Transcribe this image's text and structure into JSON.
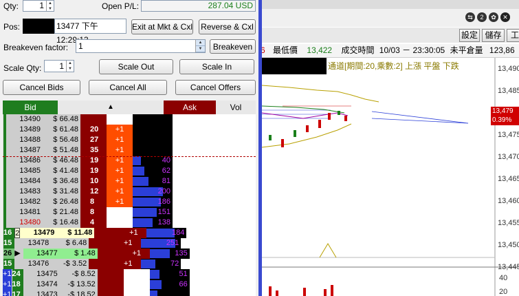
{
  "order_panel": {
    "qty_label": "Qty:",
    "qty_value": "1",
    "open_pl_label": "Open P/L:",
    "open_pl_value": "287.04 USD",
    "pos_label": "Pos:",
    "pos_info": "13477 下午 12:29:13",
    "exit_button": "Exit at Mkt & Cxl",
    "reverse_button": "Reverse & Cxl",
    "breakeven_factor_label": "Breakeven factor:",
    "breakeven_factor_value": "1",
    "breakeven_button": "Breakeven",
    "scale_qty_label": "Scale Qty:",
    "scale_qty_value": "1",
    "scale_out_button": "Scale Out",
    "scale_in_button": "Scale In",
    "cancel_bids_button": "Cancel Bids",
    "cancel_all_button": "Cancel All",
    "cancel_offers_button": "Cancel Offers"
  },
  "ladder": {
    "headers": {
      "bid": "Bid",
      "sort": "▲",
      "ask": "Ask",
      "vol": "Vol"
    },
    "rows": [
      {
        "price": "13490",
        "pl": "$ 66.48",
        "myb": "",
        "bid": "",
        "myo": "",
        "ask": "",
        "aplus": "",
        "vol": "",
        "vf": 0
      },
      {
        "price": "13489",
        "pl": "$ 61.48",
        "myb": "",
        "bid": "",
        "myo": "",
        "ask": "20",
        "aplus": "+1",
        "vol": "",
        "vf": 0
      },
      {
        "price": "13488",
        "pl": "$ 56.48",
        "myb": "",
        "bid": "",
        "myo": "",
        "ask": "27",
        "aplus": "+1",
        "vol": "",
        "vf": 0
      },
      {
        "price": "13487",
        "pl": "$ 51.48",
        "myb": "",
        "bid": "",
        "myo": "",
        "ask": "35",
        "aplus": "+1",
        "vol": "",
        "vf": 0
      },
      {
        "price": "13486",
        "pl": "$ 46.48",
        "myb": "",
        "bid": "",
        "myo": "",
        "ask": "19",
        "aplus": "+1",
        "vol": "40",
        "vf": 0.2
      },
      {
        "price": "13485",
        "pl": "$ 41.48",
        "myb": "",
        "bid": "",
        "myo": "",
        "ask": "19",
        "aplus": "+1",
        "vol": "62",
        "vf": 0.3
      },
      {
        "price": "13484",
        "pl": "$ 36.48",
        "myb": "",
        "bid": "",
        "myo": "",
        "ask": "10",
        "aplus": "+1",
        "vol": "81",
        "vf": 0.4
      },
      {
        "price": "13483",
        "pl": "$ 31.48",
        "myb": "",
        "bid": "",
        "myo": "",
        "ask": "12",
        "aplus": "+1",
        "vol": "200",
        "vf": 0.75
      },
      {
        "price": "13482",
        "pl": "$ 26.48",
        "myb": "",
        "bid": "",
        "myo": "",
        "ask": "8",
        "aplus": "+1",
        "vol": "186",
        "vf": 0.7
      },
      {
        "price": "13481",
        "pl": "$ 21.48",
        "myb": "",
        "bid": "",
        "myo": "",
        "ask": "8",
        "aplus": "",
        "vol": "151",
        "vf": 0.6
      },
      {
        "price": "13480",
        "pl": "$ 16.48",
        "myb": "",
        "bid": "",
        "myo": "",
        "ask": "4",
        "aplus": "",
        "vol": "138",
        "vf": 0.5
      },
      {
        "price": "13479",
        "pl": "$ 11.48",
        "myb": "",
        "bid": "16",
        "myo": "2",
        "ask": "",
        "aplus": "+1",
        "vol": "184",
        "vf": 0.7
      },
      {
        "price": "13478",
        "pl": "$ 6.48",
        "myb": "",
        "bid": "15",
        "myo": "",
        "ask": "",
        "aplus": "+1",
        "vol": "251",
        "vf": 0.85
      },
      {
        "price": "13477",
        "pl": "$ 1.48",
        "myb": "",
        "bid": "26",
        "myo": "▶",
        "ask": "",
        "aplus": "+1",
        "vol": "135",
        "vf": 0.5
      },
      {
        "price": "13476",
        "pl": "-$ 3.52",
        "myb": "",
        "bid": "15",
        "myo": "",
        "ask": "",
        "aplus": "+1",
        "vol": "72",
        "vf": 0.35
      },
      {
        "price": "13475",
        "pl": "-$ 8.52",
        "myb": "+1",
        "bid": "24",
        "myo": "",
        "ask": "",
        "aplus": "",
        "vol": "51",
        "vf": 0.25
      },
      {
        "price": "13474",
        "pl": "-$ 13.52",
        "myb": "+1",
        "bid": "18",
        "myo": "",
        "ask": "",
        "aplus": "",
        "vol": "66",
        "vf": 0.3
      },
      {
        "price": "13473",
        "pl": "-$ 18.52",
        "myb": "+1",
        "bid": "17",
        "myo": "",
        "ask": "",
        "aplus": "",
        "vol": "",
        "vf": 0.2
      }
    ]
  },
  "chart_panel": {
    "toolbar_buttons": [
      "設定",
      "儲存",
      "工"
    ],
    "info_prefix": "6",
    "low_label": "最低價",
    "low_value": "13,422",
    "time_label": "成交時間",
    "time_value": "10/03 － 23:30:05",
    "unfilled_label": "未平倉量",
    "unfilled_value": "123,86",
    "indicator_text": "通道[期間:20,乘數:2] 上漲  平盤  下跌",
    "price_ticks": [
      "13,490",
      "13,485",
      "13,480",
      "13,475",
      "13,470",
      "13,465",
      "13,460",
      "13,455",
      "13,450",
      "13,445"
    ],
    "last_price": "13,479",
    "last_change": "0.39%",
    "vol_ticks": [
      "40",
      "20"
    ]
  },
  "colors": {
    "bid_green": "#1f7d1f",
    "ask_red": "#8b0000",
    "plus_orange": "#ff4d00",
    "vol_blue": "#2b3fd8",
    "vol_text": "#cc33ff"
  }
}
